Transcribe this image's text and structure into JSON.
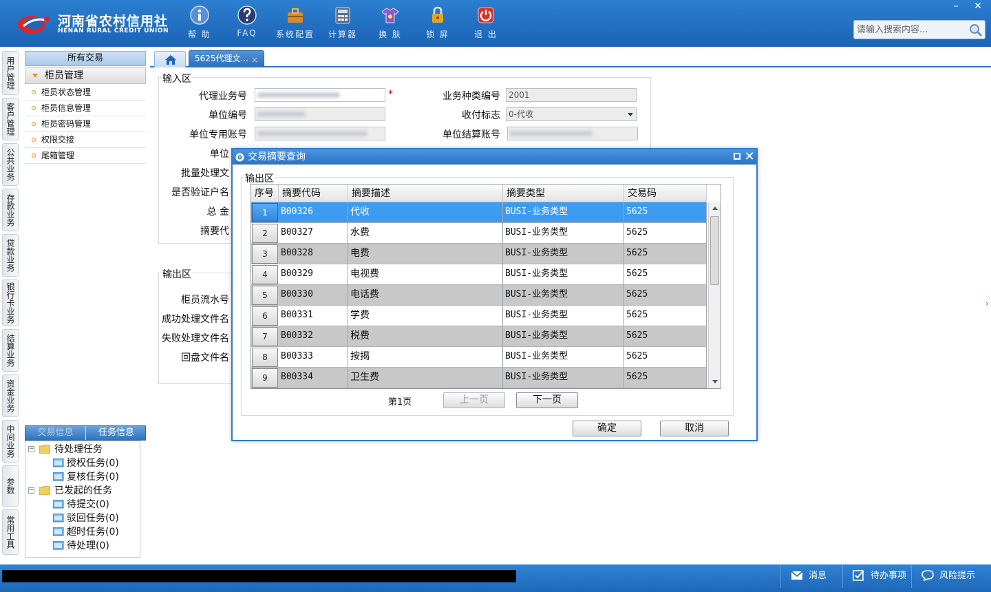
{
  "logo": {
    "cn": "河南省农村信用社",
    "en": "HENAN RURAL CREDIT UNION"
  },
  "toolbar": [
    {
      "label": "帮 助",
      "icon": "info-icon"
    },
    {
      "label": "FAQ",
      "icon": "question-icon"
    },
    {
      "label": "系统配置",
      "icon": "toolbox-icon"
    },
    {
      "label": "计算器",
      "icon": "calculator-icon"
    },
    {
      "label": "换 肤",
      "icon": "shirt-icon"
    },
    {
      "label": "锁 屏",
      "icon": "lock-icon"
    },
    {
      "label": "退 出",
      "icon": "power-icon"
    }
  ],
  "window": {
    "min": "–",
    "close": "✕"
  },
  "search": {
    "placeholder": "请输入搜索内容..."
  },
  "vertical_menu": [
    "用户管理",
    "客户管理",
    "公共业务",
    "存款业务",
    "贷款业务",
    "银行卡业务",
    "结算业务",
    "资金业务",
    "中间业务",
    "参数",
    "常用工具"
  ],
  "left_panel": {
    "all_transactions": "所有交易",
    "section": "柜员管理",
    "items": [
      "柜员状态管理",
      "柜员信息管理",
      "柜员密码管理",
      "权限交接",
      "尾箱管理"
    ],
    "info_tabs": {
      "trans_info": "交易信息",
      "task_info": "任务信息"
    },
    "tree": {
      "pending": "待处理任务",
      "pending_children": [
        "授权任务(0)",
        "复核任务(0)"
      ],
      "initiated": "已发起的任务",
      "initiated_children": [
        "待提交(0)",
        "驳回任务(0)",
        "超时任务(0)",
        "待处理(0)"
      ],
      "toggle": "−"
    }
  },
  "tabs": {
    "active": "5625代理文...",
    "close": "×"
  },
  "input_section": {
    "legend": "输入区",
    "labels": {
      "agent_no": "代理业务号",
      "unit_no": "单位编号",
      "unit_account": "单位专用账号",
      "unit_partial": "单位",
      "batch_partial": "批量处理文",
      "verify_partial": "是否验证户名",
      "total_partial": "总  金",
      "summary_partial": "摘要代",
      "biz_type_no": "业务种类编号",
      "pay_flag": "收付标志",
      "settle_account": "单位结算账号"
    },
    "values": {
      "biz_type_no": "2001",
      "pay_flag": "0-代收"
    },
    "required_mark": "*"
  },
  "output_section": {
    "legend": "输出区",
    "labels": {
      "teller_serial": "柜员流水号",
      "success_file": "成功处理文件名",
      "fail_file": "失败处理文件名",
      "return_file": "回盘文件名"
    }
  },
  "modal": {
    "title": "交易摘要查询",
    "legend": "输出区",
    "max": "",
    "close": "✕",
    "columns": [
      "序号",
      "摘要代码",
      "摘要描述",
      "摘要类型",
      "交易码"
    ],
    "rows": [
      {
        "no": "1",
        "code": "B00326",
        "desc": "代收",
        "type": "BUSI-业务类型",
        "tcode": "5625"
      },
      {
        "no": "2",
        "code": "B00327",
        "desc": "水费",
        "type": "BUSI-业务类型",
        "tcode": "5625"
      },
      {
        "no": "3",
        "code": "B00328",
        "desc": "电费",
        "type": "BUSI-业务类型",
        "tcode": "5625"
      },
      {
        "no": "4",
        "code": "B00329",
        "desc": "电视费",
        "type": "BUSI-业务类型",
        "tcode": "5625"
      },
      {
        "no": "5",
        "code": "B00330",
        "desc": "电话费",
        "type": "BUSI-业务类型",
        "tcode": "5625"
      },
      {
        "no": "6",
        "code": "B00331",
        "desc": "学费",
        "type": "BUSI-业务类型",
        "tcode": "5625"
      },
      {
        "no": "7",
        "code": "B00332",
        "desc": "税费",
        "type": "BUSI-业务类型",
        "tcode": "5625"
      },
      {
        "no": "8",
        "code": "B00333",
        "desc": "按揭",
        "type": "BUSI-业务类型",
        "tcode": "5625"
      },
      {
        "no": "9",
        "code": "B00334",
        "desc": "卫生费",
        "type": "BUSI-业务类型",
        "tcode": "5625"
      }
    ],
    "selected_row": 0,
    "page_info": "第1页",
    "prev": "上一页",
    "next": "下一页",
    "ok": "确定",
    "cancel": "取消"
  },
  "statusbar": {
    "message": "消息",
    "todo": "待办事项",
    "risk": "风险提示"
  },
  "right_chevron": "›",
  "colors": {
    "primary": "#2b72c4",
    "selected_row": "#3e9bf2",
    "alt_row": "#c8c8c8",
    "required": "#dd0000"
  }
}
